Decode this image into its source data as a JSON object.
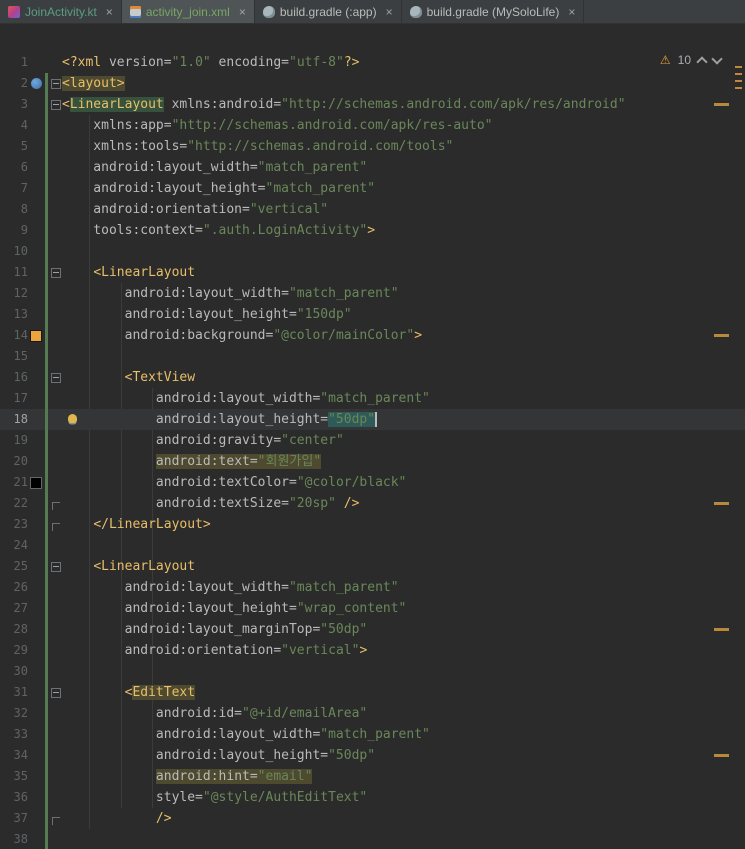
{
  "colors": {
    "editor_bg": "#2b2b2b",
    "tabbar_bg": "#3c3f41",
    "tag": "#e8bf6a",
    "attr": "#bababa",
    "value": "#6a8759",
    "warning": "#b9893b",
    "vcs_added": "#567a52",
    "main_color_swatch": "#eea43c",
    "black_swatch": "#000000"
  },
  "tabs": [
    {
      "label": "JoinActivity.kt",
      "icon": "kotlin-file-icon",
      "active": false,
      "label_color": "#5d9b85"
    },
    {
      "label": "activity_join.xml",
      "icon": "layout-xml-file-icon",
      "active": true,
      "label_color": "#77a665"
    },
    {
      "label": "build.gradle (:app)",
      "icon": "gradle-file-icon",
      "active": false,
      "label_color": "#bbbbbb"
    },
    {
      "label": "build.gradle (MySoloLife)",
      "icon": "gradle-file-icon",
      "active": false,
      "label_color": "#bbbbbb"
    }
  ],
  "inspection": {
    "warning_symbol": "⚠",
    "warning_count": "10"
  },
  "editor": {
    "lines": [
      {
        "n": 1,
        "vcs": false,
        "segs": [
          [
            "<?xml ",
            "tag"
          ],
          [
            "version=",
            "attr"
          ],
          [
            "\"1.0\"",
            "val"
          ],
          [
            " encoding=",
            "attr"
          ],
          [
            "\"utf-8\"",
            "val"
          ],
          [
            "?>",
            "tag"
          ]
        ]
      },
      {
        "n": 2,
        "fold": "minus",
        "icon": "preview",
        "segs": [
          [
            "<layout>",
            "tag hl"
          ]
        ]
      },
      {
        "n": 3,
        "fold": "minus",
        "mark": true,
        "segs": [
          [
            "<",
            "tag"
          ],
          [
            "LinearLayout",
            "tag hlg"
          ],
          [
            " xmlns:android=",
            "attr"
          ],
          [
            "\"http://schemas.android.com/apk/res/android\"",
            "val"
          ]
        ]
      },
      {
        "n": 4,
        "segs": [
          [
            "    xmlns:app=",
            "attr"
          ],
          [
            "\"http://schemas.android.com/apk/res-auto\"",
            "val"
          ]
        ]
      },
      {
        "n": 5,
        "segs": [
          [
            "    xmlns:tools=",
            "attr"
          ],
          [
            "\"http://schemas.android.com/tools\"",
            "val"
          ]
        ]
      },
      {
        "n": 6,
        "segs": [
          [
            "    android:layout_width=",
            "attr"
          ],
          [
            "\"match_parent\"",
            "val"
          ]
        ]
      },
      {
        "n": 7,
        "segs": [
          [
            "    android:layout_height=",
            "attr"
          ],
          [
            "\"match_parent\"",
            "val"
          ]
        ]
      },
      {
        "n": 8,
        "segs": [
          [
            "    android:orientation=",
            "attr"
          ],
          [
            "\"vertical\"",
            "val"
          ]
        ]
      },
      {
        "n": 9,
        "segs": [
          [
            "    tools:context=",
            "attr"
          ],
          [
            "\".auth.LoginActivity\"",
            "val"
          ],
          [
            ">",
            "tag"
          ]
        ]
      },
      {
        "n": 10,
        "segs": []
      },
      {
        "n": 11,
        "fold": "minus",
        "segs": [
          [
            "    ",
            "plain"
          ],
          [
            "<LinearLayout",
            "tag"
          ]
        ]
      },
      {
        "n": 12,
        "segs": [
          [
            "        android:layout_width=",
            "attr"
          ],
          [
            "\"match_parent\"",
            "val"
          ]
        ]
      },
      {
        "n": 13,
        "segs": [
          [
            "        android:layout_height=",
            "attr"
          ],
          [
            "\"150dp\"",
            "val"
          ]
        ]
      },
      {
        "n": 14,
        "icon": "color-orange",
        "mark": true,
        "segs": [
          [
            "        android:background=",
            "attr"
          ],
          [
            "\"@color/mainColor\"",
            "val"
          ],
          [
            ">",
            "tag"
          ]
        ]
      },
      {
        "n": 15,
        "segs": []
      },
      {
        "n": 16,
        "fold": "minus",
        "segs": [
          [
            "        ",
            "plain"
          ],
          [
            "<TextView",
            "tag"
          ]
        ]
      },
      {
        "n": 17,
        "segs": [
          [
            "            android:layout_width=",
            "attr"
          ],
          [
            "\"match_parent\"",
            "val"
          ]
        ]
      },
      {
        "n": 18,
        "current": true,
        "bulb": true,
        "segs": [
          [
            "            android:layout_height=",
            "attr"
          ],
          [
            "\"50dp\"",
            "val sel"
          ],
          [
            "",
            "caret"
          ]
        ]
      },
      {
        "n": 19,
        "segs": [
          [
            "            android:gravity=",
            "attr"
          ],
          [
            "\"center\"",
            "val"
          ]
        ]
      },
      {
        "n": 20,
        "segs": [
          [
            "            ",
            "plain"
          ],
          [
            "android:text=",
            "attr hl"
          ],
          [
            "\"회원가입\"",
            "val hl"
          ]
        ]
      },
      {
        "n": 21,
        "icon": "color-black",
        "segs": [
          [
            "            android:textColor=",
            "attr"
          ],
          [
            "\"@color/black\"",
            "val"
          ]
        ]
      },
      {
        "n": 22,
        "fold": "end",
        "mark": true,
        "segs": [
          [
            "            android:textSize=",
            "attr"
          ],
          [
            "\"20sp\"",
            "val"
          ],
          [
            " />",
            "tag"
          ]
        ]
      },
      {
        "n": 23,
        "fold": "end",
        "segs": [
          [
            "    ",
            "plain"
          ],
          [
            "</LinearLayout>",
            "tag"
          ]
        ]
      },
      {
        "n": 24,
        "segs": []
      },
      {
        "n": 25,
        "fold": "minus",
        "segs": [
          [
            "    ",
            "plain"
          ],
          [
            "<LinearLayout",
            "tag"
          ]
        ]
      },
      {
        "n": 26,
        "segs": [
          [
            "        android:layout_width=",
            "attr"
          ],
          [
            "\"match_parent\"",
            "val"
          ]
        ]
      },
      {
        "n": 27,
        "segs": [
          [
            "        android:layout_height=",
            "attr"
          ],
          [
            "\"wrap_content\"",
            "val"
          ]
        ]
      },
      {
        "n": 28,
        "mark": true,
        "segs": [
          [
            "        android:layout_marginTop=",
            "attr"
          ],
          [
            "\"50dp\"",
            "val"
          ]
        ]
      },
      {
        "n": 29,
        "segs": [
          [
            "        android:orientation=",
            "attr"
          ],
          [
            "\"vertical\"",
            "val"
          ],
          [
            ">",
            "tag"
          ]
        ]
      },
      {
        "n": 30,
        "segs": []
      },
      {
        "n": 31,
        "fold": "minus",
        "segs": [
          [
            "        ",
            "plain"
          ],
          [
            "<",
            "tag"
          ],
          [
            "EditText",
            "tag hl"
          ]
        ]
      },
      {
        "n": 32,
        "segs": [
          [
            "            android:id=",
            "attr"
          ],
          [
            "\"@+id/emailArea\"",
            "val"
          ]
        ]
      },
      {
        "n": 33,
        "segs": [
          [
            "            android:layout_width=",
            "attr"
          ],
          [
            "\"match_parent\"",
            "val"
          ]
        ]
      },
      {
        "n": 34,
        "mark": true,
        "segs": [
          [
            "            android:layout_height=",
            "attr"
          ],
          [
            "\"50dp\"",
            "val"
          ]
        ]
      },
      {
        "n": 35,
        "segs": [
          [
            "            ",
            "plain"
          ],
          [
            "android:hint=",
            "attr hl"
          ],
          [
            "\"email\"",
            "val hl"
          ]
        ]
      },
      {
        "n": 36,
        "segs": [
          [
            "            style=",
            "attr"
          ],
          [
            "\"@style/AuthEditText\"",
            "val"
          ]
        ]
      },
      {
        "n": 37,
        "fold": "end",
        "segs": [
          [
            "            />",
            "tag"
          ]
        ]
      },
      {
        "n": 38,
        "segs": []
      }
    ]
  },
  "stripe_ticks_y": [
    66,
    73,
    80,
    87
  ]
}
